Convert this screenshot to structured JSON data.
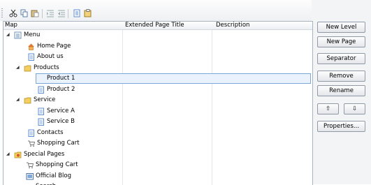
{
  "toolbar": {
    "buttons": [
      "cut-icon",
      "copy-icon",
      "paste-icon",
      "indent-icon",
      "outdent-icon",
      "page-icon",
      "properties-icon"
    ]
  },
  "grid": {
    "columns": [
      "Map",
      "Extended Page Title",
      "Description"
    ],
    "rows": [
      {
        "label": "Menu",
        "level": 0,
        "expander": "◢",
        "icon": "menu-icon"
      },
      {
        "label": "Home Page",
        "level": 2,
        "expander": "",
        "icon": "home-icon"
      },
      {
        "label": "About us",
        "level": 2,
        "expander": "",
        "icon": "page-icon"
      },
      {
        "label": "Products",
        "level": 1,
        "expander": "◢",
        "icon": "folder-icon"
      },
      {
        "label": "Product 1",
        "level": 3,
        "expander": "",
        "icon": "page-icon",
        "selected": true
      },
      {
        "label": "Product 2",
        "level": 3,
        "expander": "",
        "icon": "page-icon"
      },
      {
        "label": "Service",
        "level": 1,
        "expander": "◢",
        "icon": "folder-icon"
      },
      {
        "label": "Service A",
        "level": 3,
        "expander": "",
        "icon": "page-icon"
      },
      {
        "label": "Service B",
        "level": 3,
        "expander": "",
        "icon": "page-icon"
      },
      {
        "label": "Contacts",
        "level": 2,
        "expander": "",
        "icon": "page-icon"
      },
      {
        "label": "Shopping Cart",
        "level": 2,
        "expander": "",
        "icon": "cart-icon"
      },
      {
        "label": "Special Pages",
        "level": -1,
        "expander": "◢",
        "icon": "special-folder-icon"
      },
      {
        "label": "Shopping Cart",
        "level": 1.5,
        "expander": "",
        "icon": "cart-icon"
      },
      {
        "label": "Official Blog",
        "level": 1.5,
        "expander": "",
        "icon": "blog-icon"
      },
      {
        "label": "Search",
        "level": 1.5,
        "expander": "",
        "icon": "search-icon"
      }
    ]
  },
  "buttons": {
    "new_level": "New Level",
    "new_page": "New Page",
    "separator": "Separator",
    "remove": "Remove",
    "rename": "Rename",
    "move_up": "⇧",
    "move_down": "⇩",
    "properties": "Properties..."
  },
  "colors": {
    "selection": "#eaf3fd",
    "selection_border": "#7ba7d8",
    "folder": "#e8c14a",
    "page": "#5b8ed6"
  }
}
